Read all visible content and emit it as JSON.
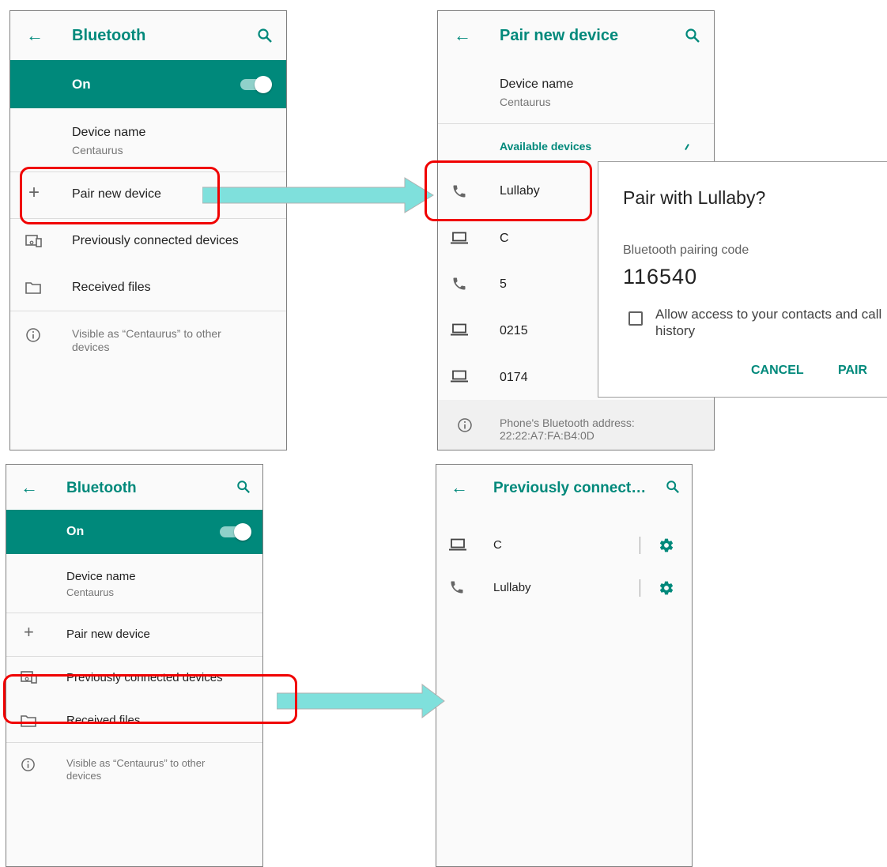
{
  "panel1": {
    "title": "Bluetooth",
    "on_label": "On",
    "device_name_label": "Device name",
    "device_name_value": "Centaurus",
    "pair_new": "Pair new device",
    "prev_connected": "Previously connected devices",
    "received_files": "Received files",
    "visible_as": "Visible as “Centaurus” to other devices"
  },
  "panel2": {
    "title": "Pair new device",
    "device_name_label": "Device name",
    "device_name_value": "Centaurus",
    "available_devices": "Available devices",
    "devices": [
      {
        "name": "Lullaby",
        "icon": "phone-icon"
      },
      {
        "name": "C",
        "icon": "laptop-icon"
      },
      {
        "name": "5",
        "icon": "phone-icon"
      },
      {
        "name": "0215",
        "icon": "laptop-icon"
      },
      {
        "name": "0174",
        "icon": "laptop-icon"
      }
    ],
    "bt_address_line1": "Phone's Bluetooth address:",
    "bt_address_line2": "22:22:A7:FA:B4:0D"
  },
  "dialog": {
    "title": "Pair with Lullaby?",
    "code_label": "Bluetooth pairing code",
    "code": "116540",
    "checkbox_label": "Allow access to your contacts and call history",
    "cancel": "CANCEL",
    "pair": "PAIR"
  },
  "panel3": {
    "title": "Bluetooth",
    "on_label": "On",
    "device_name_label": "Device name",
    "device_name_value": "Centaurus",
    "pair_new": "Pair new device",
    "prev_connected": "Previously connected devices",
    "received_files": "Received files",
    "visible_as": "Visible as “Centaurus” to other devices"
  },
  "panel4": {
    "title": "Previously connect…",
    "devices": [
      {
        "name": "C",
        "icon": "laptop-icon"
      },
      {
        "name": "Lullaby",
        "icon": "phone-icon"
      }
    ]
  },
  "colors": {
    "accent": "#00897b",
    "highlight": "#f00000",
    "arrow": "#7fe0dc"
  }
}
